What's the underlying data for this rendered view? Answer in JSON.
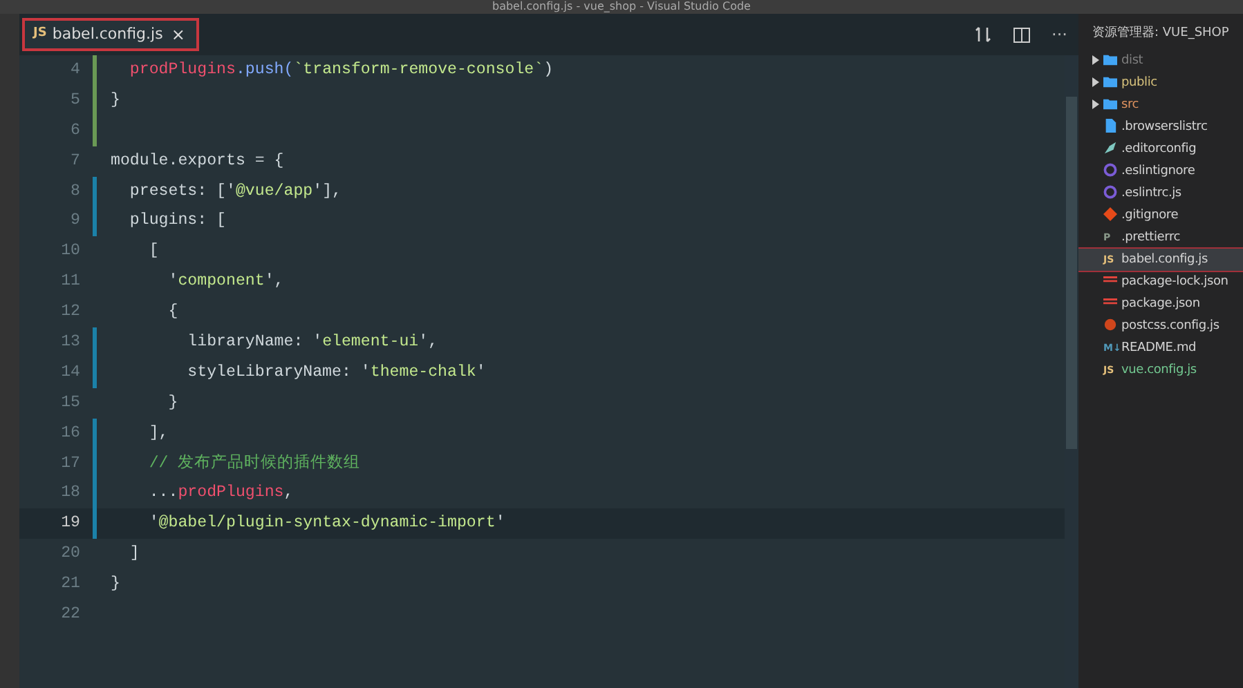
{
  "window": {
    "title": "babel.config.js - vue_shop - Visual Studio Code"
  },
  "tabs": [
    {
      "icon_text": "JS",
      "label": "babel.config.js",
      "close": "×",
      "selected": true
    }
  ],
  "editor_actions": {
    "more": "···"
  },
  "code_lines": [
    {
      "number": "4",
      "added": true,
      "modified": false,
      "current": false,
      "tokens": [
        {
          "kind": "var",
          "text": "  prodPlugins"
        },
        {
          "kind": "method",
          "text": ".push("
        },
        {
          "kind": "string",
          "text": "`transform-remove-console`"
        },
        {
          "kind": "plain",
          "text": ")"
        }
      ]
    },
    {
      "number": "5",
      "added": true,
      "modified": false,
      "current": false,
      "tokens": [
        {
          "kind": "plain",
          "text": "}"
        }
      ]
    },
    {
      "number": "6",
      "added": true,
      "modified": false,
      "current": false
    },
    {
      "number": "7",
      "added": false,
      "modified": false,
      "current": false,
      "tokens": [
        {
          "kind": "plain",
          "text": "module.exports = {"
        }
      ]
    },
    {
      "number": "8",
      "added": false,
      "modified": true,
      "current": false,
      "tokens": [
        {
          "kind": "plain",
          "text": "  presets: ['"
        },
        {
          "kind": "string",
          "text": "@vue/app"
        },
        {
          "kind": "plain",
          "text": "'],"
        }
      ]
    },
    {
      "number": "9",
      "added": false,
      "modified": true,
      "current": false,
      "tokens": [
        {
          "kind": "plain",
          "text": "  plugins: ["
        }
      ]
    },
    {
      "number": "10",
      "added": false,
      "modified": false,
      "current": false,
      "tokens": [
        {
          "kind": "plain",
          "text": "    ["
        }
      ]
    },
    {
      "number": "11",
      "added": false,
      "modified": false,
      "current": false,
      "tokens": [
        {
          "kind": "plain",
          "text": "      '"
        },
        {
          "kind": "string",
          "text": "component"
        },
        {
          "kind": "plain",
          "text": "',"
        }
      ]
    },
    {
      "number": "12",
      "added": false,
      "modified": false,
      "current": false,
      "tokens": [
        {
          "kind": "plain",
          "text": "      {"
        }
      ]
    },
    {
      "number": "13",
      "added": false,
      "modified": true,
      "current": false,
      "tokens": [
        {
          "kind": "plain",
          "text": "        libraryName: '"
        },
        {
          "kind": "string",
          "text": "element-ui"
        },
        {
          "kind": "plain",
          "text": "',"
        }
      ]
    },
    {
      "number": "14",
      "added": false,
      "modified": true,
      "current": false,
      "tokens": [
        {
          "kind": "plain",
          "text": "        styleLibraryName: '"
        },
        {
          "kind": "string",
          "text": "theme-chalk"
        },
        {
          "kind": "plain",
          "text": "'"
        }
      ]
    },
    {
      "number": "15",
      "added": false,
      "modified": false,
      "current": false,
      "tokens": [
        {
          "kind": "plain",
          "text": "      }"
        }
      ]
    },
    {
      "number": "16",
      "added": false,
      "modified": true,
      "current": false,
      "tokens": [
        {
          "kind": "plain",
          "text": "    ],"
        }
      ]
    },
    {
      "number": "17",
      "added": false,
      "modified": true,
      "current": false,
      "tokens": [
        {
          "kind": "comment",
          "text": "    // 发布产品时候的插件数组"
        }
      ]
    },
    {
      "number": "18",
      "added": false,
      "modified": true,
      "current": false,
      "tokens": [
        {
          "kind": "plain",
          "text": "    ..."
        },
        {
          "kind": "var",
          "text": "prodPlugins"
        },
        {
          "kind": "plain",
          "text": ","
        }
      ]
    },
    {
      "number": "19",
      "added": false,
      "modified": true,
      "current": true,
      "tokens": [
        {
          "kind": "plain",
          "text": "    '"
        },
        {
          "kind": "string",
          "text": "@babel/plugin-syntax-dynamic-import"
        },
        {
          "kind": "plain",
          "text": "'"
        }
      ]
    },
    {
      "number": "20",
      "added": false,
      "modified": false,
      "current": false,
      "tokens": [
        {
          "kind": "plain",
          "text": "  ]"
        }
      ]
    },
    {
      "number": "21",
      "added": false,
      "modified": false,
      "current": false,
      "tokens": [
        {
          "kind": "plain",
          "text": "}"
        }
      ]
    },
    {
      "number": "22",
      "added": false,
      "modified": false,
      "current": false
    }
  ],
  "sidebar": {
    "title": "资源管理器: VUE_SHOP",
    "items": [
      {
        "kind": "folder",
        "label": "dist",
        "color": "#7f7f7f",
        "selected": false
      },
      {
        "kind": "folder",
        "label": "public",
        "color": "#d7c27c",
        "selected": false
      },
      {
        "kind": "folder",
        "label": "src",
        "color": "#e0935f",
        "selected": false
      },
      {
        "kind": "file",
        "label": ".browserslistrc",
        "color": "#d4d4d4",
        "selected": false
      },
      {
        "kind": "editorconfig",
        "label": ".editorconfig",
        "color": "#d4d4d4",
        "selected": false
      },
      {
        "kind": "eslint",
        "label": ".eslintignore",
        "color": "#d4d4d4",
        "selected": false
      },
      {
        "kind": "eslint",
        "label": ".eslintrc.js",
        "color": "#d4d4d4",
        "selected": false
      },
      {
        "kind": "git",
        "label": ".gitignore",
        "color": "#d4d4d4",
        "selected": false
      },
      {
        "kind": "prettier",
        "icon_text": "P",
        "label": ".prettierrc",
        "color": "#d4d4d4",
        "selected": false
      },
      {
        "kind": "js",
        "icon_text": "JS",
        "label": "babel.config.js",
        "color": "#d4d4d4",
        "selected": true
      },
      {
        "kind": "json",
        "label": "package-lock.json",
        "color": "#d4d4d4",
        "selected": false
      },
      {
        "kind": "json",
        "label": "package.json",
        "color": "#d4d4d4",
        "selected": false
      },
      {
        "kind": "postcss",
        "label": "postcss.config.js",
        "color": "#d4d4d4",
        "selected": false
      },
      {
        "kind": "markdown",
        "icon_text": "M↓",
        "label": "README.md",
        "color": "#d4d4d4",
        "selected": false
      },
      {
        "kind": "js",
        "icon_text": "JS",
        "label": "vue.config.js",
        "color": "#73c991",
        "selected": false
      }
    ]
  }
}
